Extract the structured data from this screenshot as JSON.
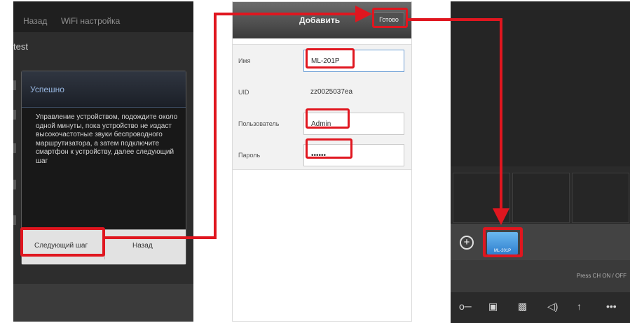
{
  "screen1": {
    "header": {
      "back_label": "Назад",
      "title": "WiFi настройка"
    },
    "device_name": "test",
    "dialog": {
      "title": "Успешно",
      "message": "Управление устройством, подождите около одной минуты, пока устройство не издаст высокочастотные звуки беспроводного маршрутизатора, а затем подключите смартфон к устройству, далее следующий шаг",
      "next_label": "Следующий шаг",
      "back_label": "Назад"
    }
  },
  "screen2": {
    "header": {
      "title": "Добавить",
      "done_label": "Готово"
    },
    "form": {
      "name_label": "Имя",
      "name_value": "ML-201P",
      "uid_label": "UID",
      "uid_value": "zz0025037ea",
      "user_label": "Пользователь",
      "user_value": "Admin",
      "password_label": "Пароль",
      "password_value": "••••••"
    }
  },
  "screen3": {
    "camera_thumb_label": "ML-201P",
    "status_text": "Press CH ON / OFF",
    "toolbar_icons": [
      "key-icon",
      "camera-icon",
      "video-icon",
      "speaker-icon",
      "microphone-icon",
      "more-icon"
    ]
  },
  "colors": {
    "highlight": "#e0161f",
    "accent_blue": "#3a8ad8"
  }
}
